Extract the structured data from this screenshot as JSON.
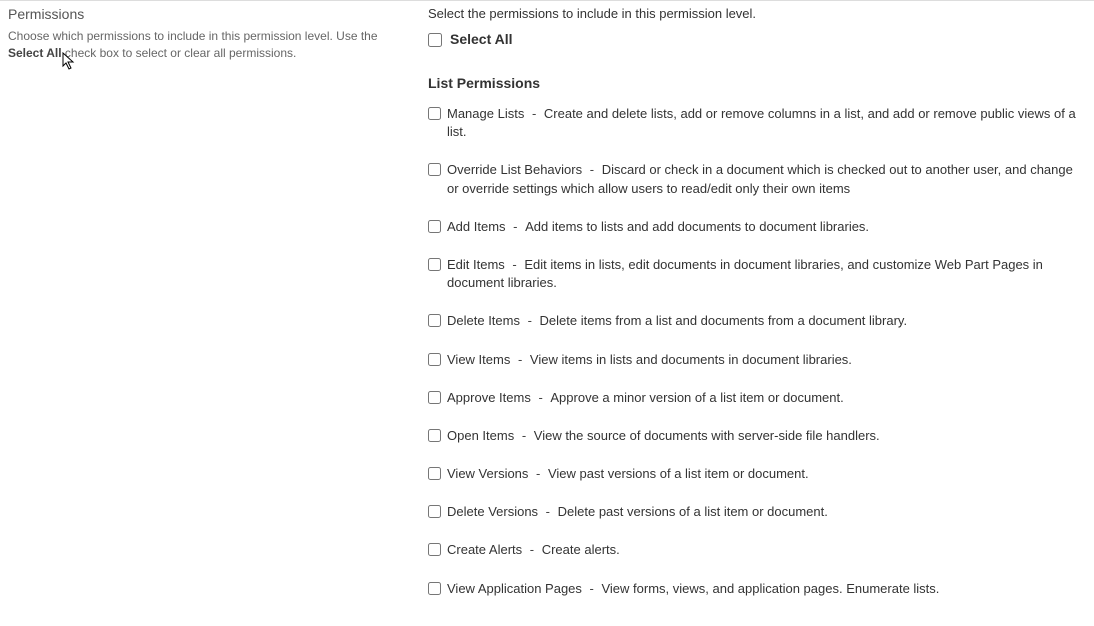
{
  "section_title": "Permissions",
  "hint_pre": "Choose which permissions to include in this permission level.  Use the ",
  "hint_bold": "Select All",
  "hint_post": " check box to select or clear all permissions.",
  "instruction": "Select the permissions to include in this permission level.",
  "select_all_label": "Select All",
  "group_heading": "List Permissions",
  "separator": "  -  ",
  "permissions": [
    {
      "name": "Manage Lists",
      "desc": "Create and delete lists, add or remove columns in a list, and add or remove public views of a list."
    },
    {
      "name": "Override List Behaviors",
      "desc": "Discard or check in a document which is checked out to another user, and change or override settings which allow users to read/edit only their own items"
    },
    {
      "name": "Add Items",
      "desc": "Add items to lists and add documents to document libraries."
    },
    {
      "name": "Edit Items",
      "desc": "Edit items in lists, edit documents in document libraries, and customize Web Part Pages in document libraries."
    },
    {
      "name": "Delete Items",
      "desc": "Delete items from a list and documents from a document library."
    },
    {
      "name": "View Items",
      "desc": "View items in lists and documents in document libraries."
    },
    {
      "name": "Approve Items",
      "desc": "Approve a minor version of a list item or document."
    },
    {
      "name": "Open Items",
      "desc": "View the source of documents with server-side file handlers."
    },
    {
      "name": "View Versions",
      "desc": "View past versions of a list item or document."
    },
    {
      "name": "Delete Versions",
      "desc": "Delete past versions of a list item or document."
    },
    {
      "name": "Create Alerts",
      "desc": "Create alerts."
    },
    {
      "name": "View Application Pages",
      "desc": "View forms, views, and application pages. Enumerate lists."
    }
  ]
}
